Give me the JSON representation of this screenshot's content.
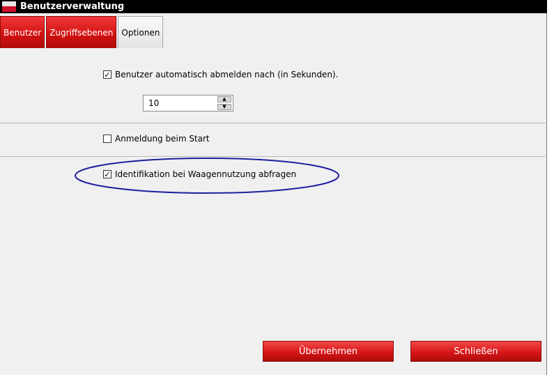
{
  "window": {
    "title": "Benutzerverwaltung"
  },
  "tabs": [
    {
      "label": "Benutzer",
      "state": "red"
    },
    {
      "label": "Zugriffsebenen",
      "state": "red"
    },
    {
      "label": "Optionen",
      "state": "active"
    }
  ],
  "options": {
    "auto_logout": {
      "label": "Benutzer automatisch abmelden nach (in Sekunden).",
      "checked": true
    },
    "logout_seconds": "10",
    "login_on_start": {
      "label": "Anmeldung beim Start",
      "checked": false
    },
    "identify_on_scale": {
      "label": "Identifikation bei Waagennutzung abfragen",
      "checked": true
    }
  },
  "buttons": {
    "apply": "Übernehmen",
    "close": "Schließen"
  },
  "colors": {
    "accent_red": "#d41212",
    "highlight": "#1e1ea0",
    "titlebar": "#000000"
  },
  "icons": {
    "check": "✓",
    "up": "▲",
    "down": "▼"
  }
}
